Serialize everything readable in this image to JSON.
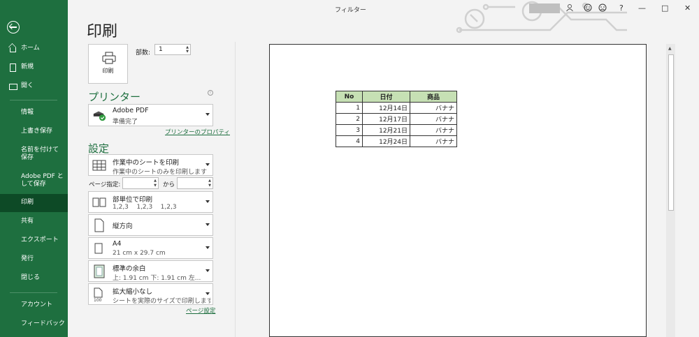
{
  "window": {
    "title": "フィルター"
  },
  "titlebar_controls": {
    "help": "?",
    "minimize": "—",
    "maximize": "□",
    "close": "✕"
  },
  "nav": {
    "items": [
      {
        "label": "ホーム"
      },
      {
        "label": "新規"
      },
      {
        "label": "開く"
      },
      {
        "label": "情報"
      },
      {
        "label": "上書き保存"
      },
      {
        "label": "名前を付けて保存"
      },
      {
        "label": "Adobe PDF として保存"
      },
      {
        "label": "印刷"
      },
      {
        "label": "共有"
      },
      {
        "label": "エクスポート"
      },
      {
        "label": "発行"
      },
      {
        "label": "閉じる"
      },
      {
        "label": "アカウント"
      },
      {
        "label": "フィードバック"
      }
    ]
  },
  "page_title": "印刷",
  "print_button": {
    "label": "印刷"
  },
  "copies": {
    "label": "部数:",
    "value": "1"
  },
  "printer": {
    "heading": "プリンター",
    "name": "Adobe PDF",
    "status": "準備完了",
    "properties_link": "プリンターのプロパティ"
  },
  "settings": {
    "heading": "設定",
    "what": {
      "main": "作業中のシートを印刷",
      "sub": "作業中のシートのみを印刷します"
    },
    "pages_label": "ページ指定:",
    "to_label": "から",
    "collate": {
      "main": "部単位で印刷",
      "sub": "1,2,3    1,2,3    1,2,3"
    },
    "orientation": {
      "main": "縦方向"
    },
    "paper": {
      "main": "A4",
      "sub": "21 cm x 29.7 cm"
    },
    "margins": {
      "main": "標準の余白",
      "sub": "上: 1.91 cm 下: 1.91 cm 左..."
    },
    "scaling": {
      "main": "拡大縮小なし",
      "sub": "シートを実際のサイズで印刷します"
    },
    "page_setup_link": "ページ設定"
  },
  "preview_table": {
    "headers": [
      "No",
      "日付",
      "商品"
    ],
    "rows": [
      [
        "1",
        "12月14日",
        "バナナ"
      ],
      [
        "2",
        "12月17日",
        "バナナ"
      ],
      [
        "3",
        "12月21日",
        "バナナ"
      ],
      [
        "4",
        "12月24日",
        "バナナ"
      ]
    ]
  }
}
